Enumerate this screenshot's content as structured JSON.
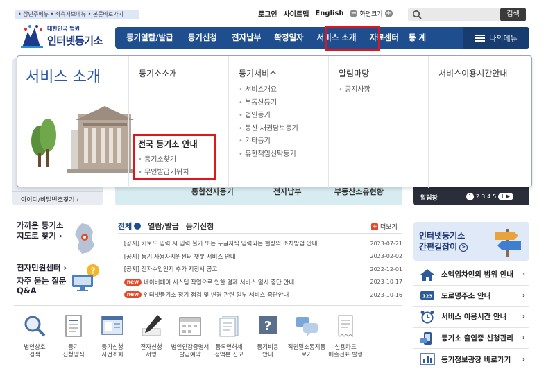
{
  "skip_links": "• 상단주메뉴 • 좌측서브메뉴 • 본문바로가기",
  "util": {
    "login": "로그인",
    "sitemap": "사이트맵",
    "english": "English",
    "zoom_label": "화면크기",
    "minus": "−",
    "plus": "+"
  },
  "search": {
    "placeholder": "",
    "button": "검색"
  },
  "logo": {
    "sub": "대한민국 법원",
    "main": "인터넷등기소"
  },
  "gnb": {
    "items": [
      "등기열람/발급",
      "등기신청",
      "전자납부",
      "확정일자",
      "서비스 소개",
      "자료센터",
      "통 계"
    ],
    "my_menu": "나의메뉴"
  },
  "mega": {
    "title": "서비스 소개",
    "columns": [
      {
        "head": "등기소소개",
        "items": []
      },
      {
        "head": "등기서비스",
        "items": [
          "서비스개요",
          "부동산등기",
          "법인등기",
          "동산·채권담보등기",
          "기타등기",
          "유한책임신탁등기"
        ]
      },
      {
        "head": "알림마당",
        "items": [
          "공지사항"
        ]
      },
      {
        "head": "서비스이용시간안내",
        "items": []
      }
    ],
    "sub_block": {
      "head": "전국 등기소 안내",
      "items": [
        "등기소찾기",
        "무인발급기위치"
      ]
    }
  },
  "background": {
    "find_id": "아이디/비밀번호찾기 ›",
    "mid_labels": [
      "통합전자등기",
      "전자납부",
      "부동산소유현황"
    ],
    "alarm": "알림창",
    "pager": [
      "1",
      "2",
      "3",
      "4",
      "5"
    ],
    "pager_ctrl": "II ▶"
  },
  "left_col": {
    "map_title_1": "가까운 등기소",
    "map_title_2": "지도로 찾기 ›",
    "civil": "전자민원센터 ›",
    "faq_1": "자주 묻는 질문",
    "faq_2": "Q&A"
  },
  "news": {
    "tab_all": "전체",
    "tab_view": "열람/발급",
    "tab_apply": "등기신청",
    "more": "더보기",
    "rows": [
      {
        "new": false,
        "text": "[공지] 키보드 입력 시 입력 불가 또는 두글자씩 입력되는 현상의 조치방법 안내",
        "date": "2023-07-21"
      },
      {
        "new": false,
        "text": "[공지] 등기 사용자지원센터 챗봇 서비스 안내",
        "date": "2023-02-02"
      },
      {
        "new": false,
        "text": "[공지] 전자수입인지 추가 지정서 공고",
        "date": "2022-12-01"
      },
      {
        "new": true,
        "text": "네이버페이 시스템 작업으로 인한 결제 서비스 일시 중단 안내",
        "date": "2023-10-17"
      },
      {
        "new": true,
        "text": "인터넷등기소 정기 점검 및 변경 관련 일부 서비스 중단안내",
        "date": "2023-10-16"
      }
    ],
    "new_label": "new"
  },
  "quick": [
    {
      "l1": "법인상호",
      "l2": "검색"
    },
    {
      "l1": "등기",
      "l2": "신청양식"
    },
    {
      "l1": "등기신청",
      "l2": "사건조회"
    },
    {
      "l1": "전자신청",
      "l2": "서명"
    },
    {
      "l1": "법인인감증명서",
      "l2": "발급예약"
    },
    {
      "l1": "등록면허세",
      "l2": "정액분 신고"
    },
    {
      "l1": "등기비용",
      "l2": "안내"
    },
    {
      "l1": "직권말소통지등",
      "l2": "보기"
    },
    {
      "l1": "신용카드",
      "l2": "매출전표 발행"
    }
  ],
  "banner": {
    "t1": "인터넷등기소",
    "t2": "간편길잡이"
  },
  "side_links": [
    "소액임차인의 범위 안내",
    "도로명주소 안내",
    "서비스 이용시간 안내",
    "등기소 출입증 신청관리",
    "등기정보광장 바로가기"
  ],
  "colors": {
    "nav": "#1f4e8f",
    "highlight": "#e0161e",
    "title": "#2a5aa5",
    "new_badge": "#e24a2a"
  }
}
